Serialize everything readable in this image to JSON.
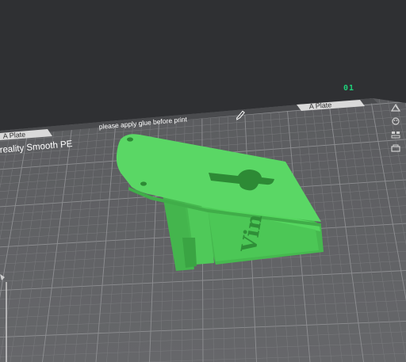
{
  "viewport": {
    "plate_number": "01",
    "plate_tab_left": "A Plate",
    "plate_tab_right": "A Plate",
    "plate_note": "please apply glue before print",
    "bed_label": "reality Smooth PE",
    "part_text": "Vin"
  },
  "colors": {
    "background": "#2f3033",
    "bed": "#636466",
    "grid_minor": "#7a7b7e",
    "grid_major": "#8e8f92",
    "part": "#55d65f",
    "accent": "#1fd07a"
  },
  "toolbar": {
    "icons": [
      "orient-icon",
      "palette-icon",
      "arrange-icon",
      "plate-settings-icon"
    ]
  }
}
